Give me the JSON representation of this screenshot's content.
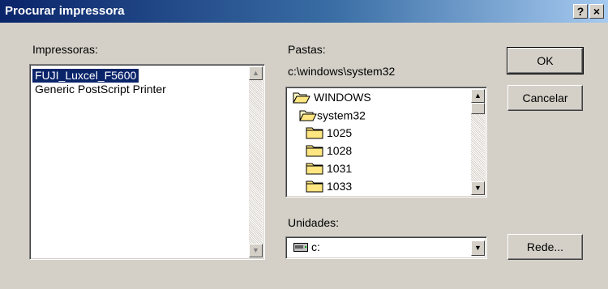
{
  "window": {
    "title": "Procurar impressora",
    "help_button": "?",
    "close_button": "×"
  },
  "printers": {
    "label": "Impressoras:",
    "items": [
      {
        "label": "FUJI_Luxcel_F5600",
        "selected": true
      },
      {
        "label": "Generic PostScript Printer",
        "selected": false
      }
    ]
  },
  "folders": {
    "label": "Pastas:",
    "current_path": "c:\\windows\\system32",
    "items": [
      {
        "label": "WINDOWS",
        "icon": "open-folder-icon"
      },
      {
        "label": "system32",
        "icon": "open-folder-icon"
      },
      {
        "label": "1025",
        "icon": "folder-icon"
      },
      {
        "label": "1028",
        "icon": "folder-icon"
      },
      {
        "label": "1031",
        "icon": "folder-icon"
      },
      {
        "label": "1033",
        "icon": "folder-icon"
      }
    ]
  },
  "drives": {
    "label": "Unidades:",
    "selected": "c:",
    "icon": "drive-icon"
  },
  "buttons": {
    "ok": "OK",
    "cancel": "Cancelar",
    "network": "Rede..."
  },
  "colors": {
    "selection": "#0a246a",
    "title_start": "#0a246a",
    "title_end": "#a6caf0",
    "face": "#d4d0c8",
    "folder_yellow": "#ffe680"
  }
}
